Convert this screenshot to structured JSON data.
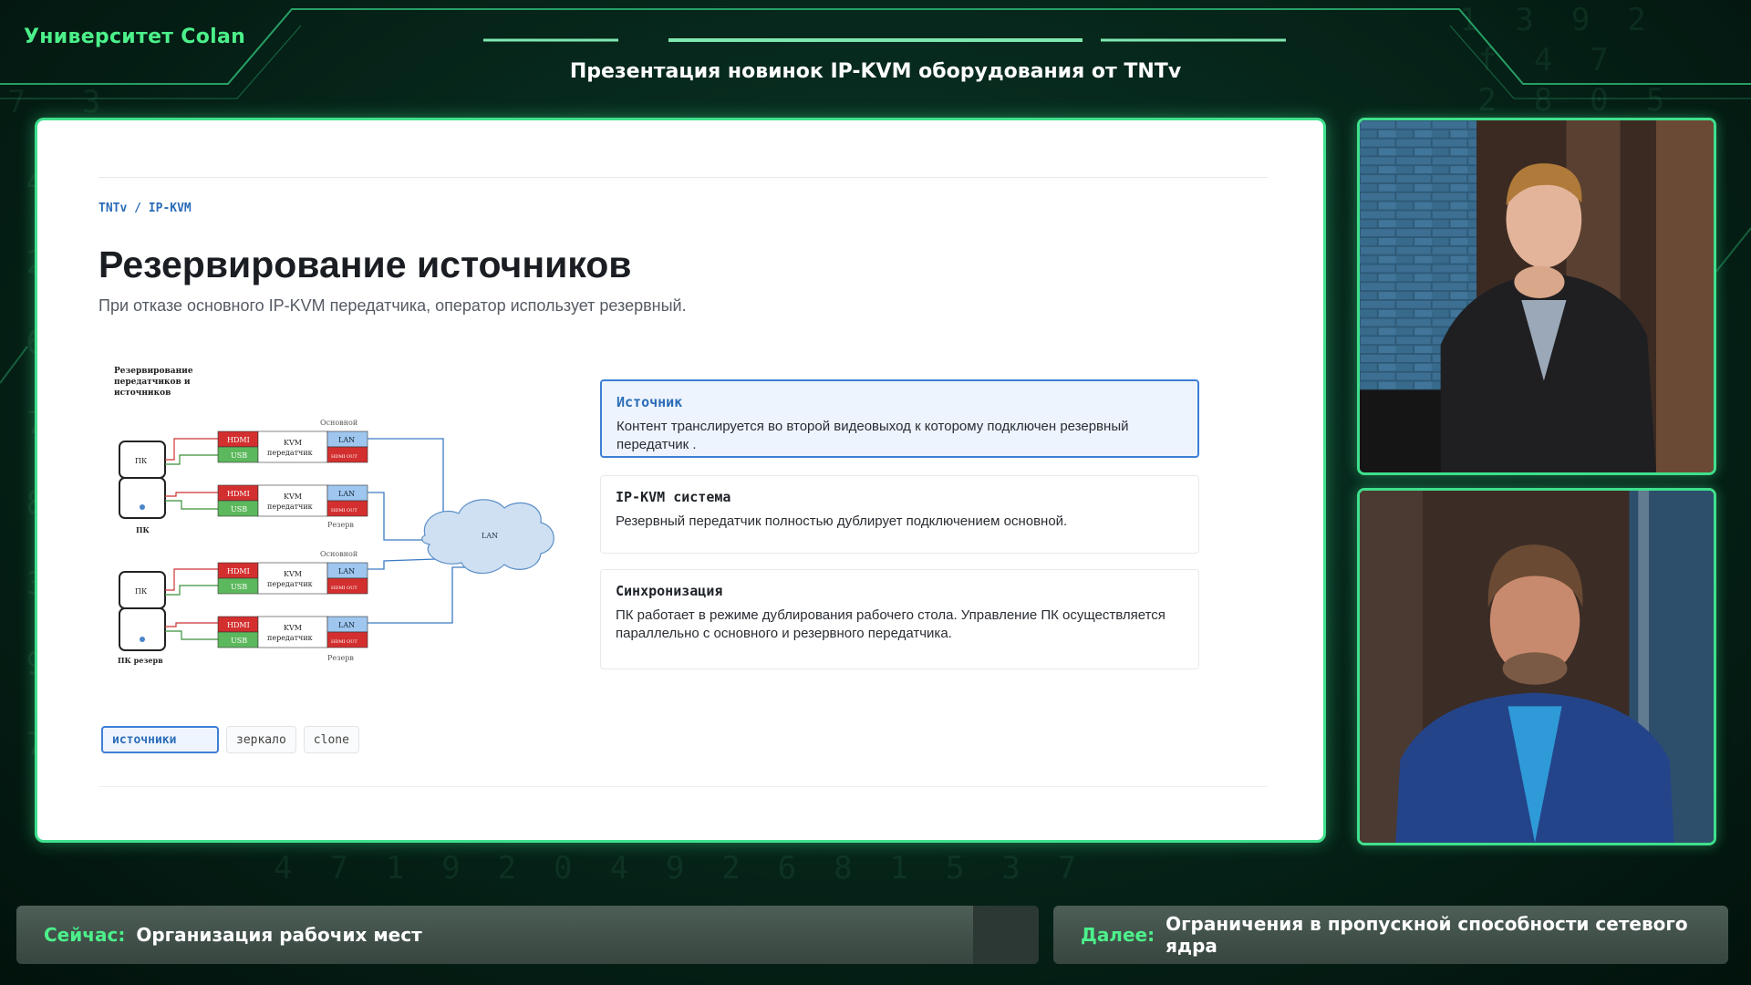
{
  "brand": "Университет Colan",
  "event_title": "Презентация новинок IP-KVM оборудования от TNTv",
  "slide": {
    "breadcrumb": "TNTv / IP-KVM",
    "title": "Резервирование источников",
    "subtitle": "При отказе основного IP-KVM передатчика, оператор использует резервный.",
    "diagram": {
      "heading_lines": [
        "Резервирование",
        "передатчиков и",
        "источников"
      ],
      "label_main": "Основной",
      "label_reserve": "Резерв",
      "pc": "ПК",
      "pc_reserve": "ПК резерв",
      "hdmi": "HDMI",
      "usb": "USB",
      "kvm": "KVM",
      "transmitter": "передатчик",
      "lan": "LAN",
      "hdmi_out": "HDMI OUT",
      "cloud": "LAN"
    },
    "cards": [
      {
        "title": "Источник",
        "text": "Контент транслируется во второй видеовыход к которому подключен резервный передатчик ."
      },
      {
        "title": "IP-KVM система",
        "text": "Резервный передатчик полностью дублирует подключением основной."
      },
      {
        "title": "Синхронизация",
        "text": "ПК работает в режиме дублирования рабочего стола. Управление ПК осуществляется параллельно с основного и резервного передатчика."
      }
    ],
    "tabs": [
      "источники",
      "зеркало",
      "clone"
    ],
    "active_tab": "источники"
  },
  "now": {
    "label": "Сейчас:",
    "value": "Организация рабочих мест"
  },
  "next": {
    "label": "Далее:",
    "value": "Ограничения в пропускной способности сетевого ядра"
  },
  "colors": {
    "accent": "#3fe08c",
    "brand": "#4cf08a",
    "link": "#2b6cb8"
  }
}
